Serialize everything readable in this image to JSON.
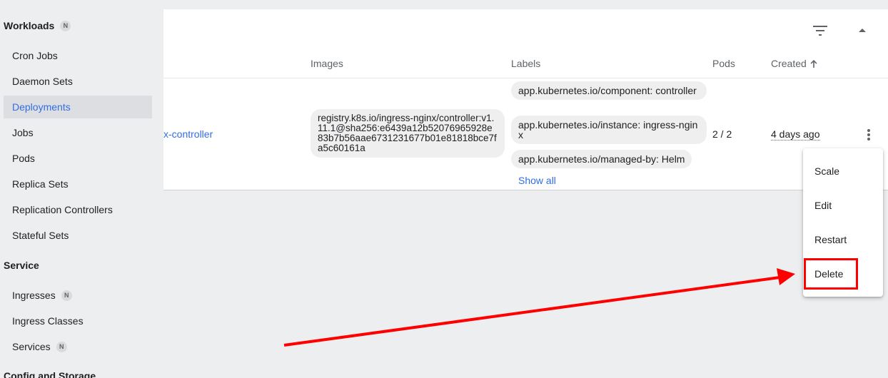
{
  "sidebar": {
    "sections": [
      {
        "title": "Workloads",
        "badge": "N"
      },
      {
        "title": "Service"
      },
      {
        "title": "Config and Storage"
      }
    ],
    "workloads": [
      "Cron Jobs",
      "Daemon Sets",
      "Deployments",
      "Jobs",
      "Pods",
      "Replica Sets",
      "Replication Controllers",
      "Stateful Sets"
    ],
    "service": [
      {
        "label": "Ingresses",
        "badge": "N"
      },
      {
        "label": "Ingress Classes"
      },
      {
        "label": "Services",
        "badge": "N"
      }
    ]
  },
  "table": {
    "headers": {
      "images": "Images",
      "labels": "Labels",
      "pods": "Pods",
      "created": "Created"
    },
    "row": {
      "name": "x-controller",
      "image": "registry.k8s.io/ingress-nginx/controller:v1.11.1@sha256:e6439a12b52076965928e83b7b56aae6731231677b01e81818bce7fa5c60161a",
      "labels": [
        "app.kubernetes.io/component: controller",
        "app.kubernetes.io/instance: ingress-nginx",
        "app.kubernetes.io/managed-by: Helm"
      ],
      "show_all": "Show all",
      "pods": "2 / 2",
      "created": "4 days ago"
    }
  },
  "menu": {
    "items": [
      "Scale",
      "Edit",
      "Restart",
      "Delete"
    ]
  },
  "colors": {
    "accent": "#326de6",
    "annotation": "#ff0000"
  },
  "icons": {
    "filter": "filter-icon",
    "collapse": "chevron-up-icon",
    "sort": "arrow-up-icon",
    "more": "more-vert-icon"
  }
}
